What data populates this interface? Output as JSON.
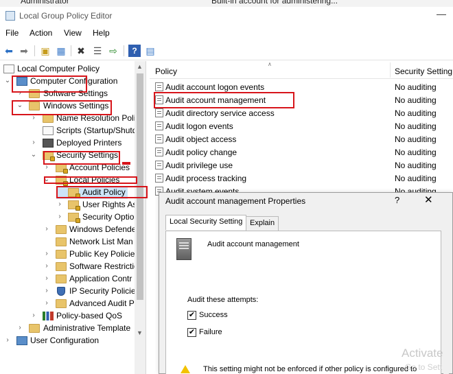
{
  "background": {
    "row_name": "Administrator",
    "row_description": "Built-in account for administering..."
  },
  "window": {
    "title": "Local Group Policy Editor",
    "minimize_glyph": "—"
  },
  "menu": [
    "File",
    "Action",
    "View",
    "Help"
  ],
  "toolbar": {
    "icons": [
      "back-icon",
      "forward-icon",
      "up-folder-icon",
      "show-hide-tree-icon",
      "delete-icon",
      "properties-icon",
      "export-list-icon",
      "help-icon",
      "view-icon"
    ]
  },
  "tree": {
    "items": [
      {
        "label": "Local Computer Policy",
        "icon": "doc-icon"
      },
      {
        "label": "Computer Configuration",
        "icon": "computer-icon"
      },
      {
        "label": "Software Settings",
        "icon": "folder-icon"
      },
      {
        "label": "Windows Settings",
        "icon": "folder-icon"
      },
      {
        "label": "Name Resolution Poli",
        "icon": "folder-icon"
      },
      {
        "label": "Scripts (Startup/Shutd",
        "icon": "script-icon"
      },
      {
        "label": "Deployed Printers",
        "icon": "printer-icon"
      },
      {
        "label": "Security Settings",
        "icon": "folder-lock-icon"
      },
      {
        "label": "Account Policies",
        "icon": "folder-lock-icon"
      },
      {
        "label": "Local Policies",
        "icon": "folder-lock-icon"
      },
      {
        "label": "Audit Policy",
        "icon": "folder-lock-icon"
      },
      {
        "label": "User Rights As",
        "icon": "folder-lock-icon"
      },
      {
        "label": "Security Optio",
        "icon": "folder-lock-icon"
      },
      {
        "label": "Windows Defende",
        "icon": "folder-icon"
      },
      {
        "label": "Network List Man",
        "icon": "folder-icon"
      },
      {
        "label": "Public Key Policie",
        "icon": "folder-icon"
      },
      {
        "label": "Software Restrictio",
        "icon": "folder-icon"
      },
      {
        "label": "Application Contr",
        "icon": "folder-icon"
      },
      {
        "label": "IP Security Policie",
        "icon": "shield-icon"
      },
      {
        "label": "Advanced Audit P",
        "icon": "folder-icon"
      },
      {
        "label": "Policy-based QoS",
        "icon": "chart-icon"
      },
      {
        "label": "Administrative Template",
        "icon": "folder-icon"
      },
      {
        "label": "User Configuration",
        "icon": "user-icon"
      }
    ]
  },
  "list": {
    "col_policy": "Policy",
    "col_setting": "Security Setting",
    "rows": [
      {
        "policy": "Audit account logon events",
        "setting": "No auditing"
      },
      {
        "policy": "Audit account management",
        "setting": "No auditing"
      },
      {
        "policy": "Audit directory service access",
        "setting": "No auditing"
      },
      {
        "policy": "Audit logon events",
        "setting": "No auditing"
      },
      {
        "policy": "Audit object access",
        "setting": "No auditing"
      },
      {
        "policy": "Audit policy change",
        "setting": "No auditing"
      },
      {
        "policy": "Audit privilege use",
        "setting": "No auditing"
      },
      {
        "policy": "Audit process tracking",
        "setting": "No auditing"
      },
      {
        "policy": "Audit system events",
        "setting": "No auditing"
      }
    ]
  },
  "dialog": {
    "title": "Audit account management Properties",
    "help_glyph": "?",
    "close_glyph": "✕",
    "tabs": [
      "Local Security Setting",
      "Explain"
    ],
    "policy_name": "Audit account management",
    "attempts_label": "Audit these attempts:",
    "success_label": "Success",
    "success_checked": "✔",
    "failure_label": "Failure",
    "failure_checked": "✔",
    "warning_text": "This setting might not be enforced if other policy is configured to"
  },
  "watermark": {
    "line1": "Activate",
    "line2": "Go to Sett"
  },
  "highlight_color": "#d7141a"
}
